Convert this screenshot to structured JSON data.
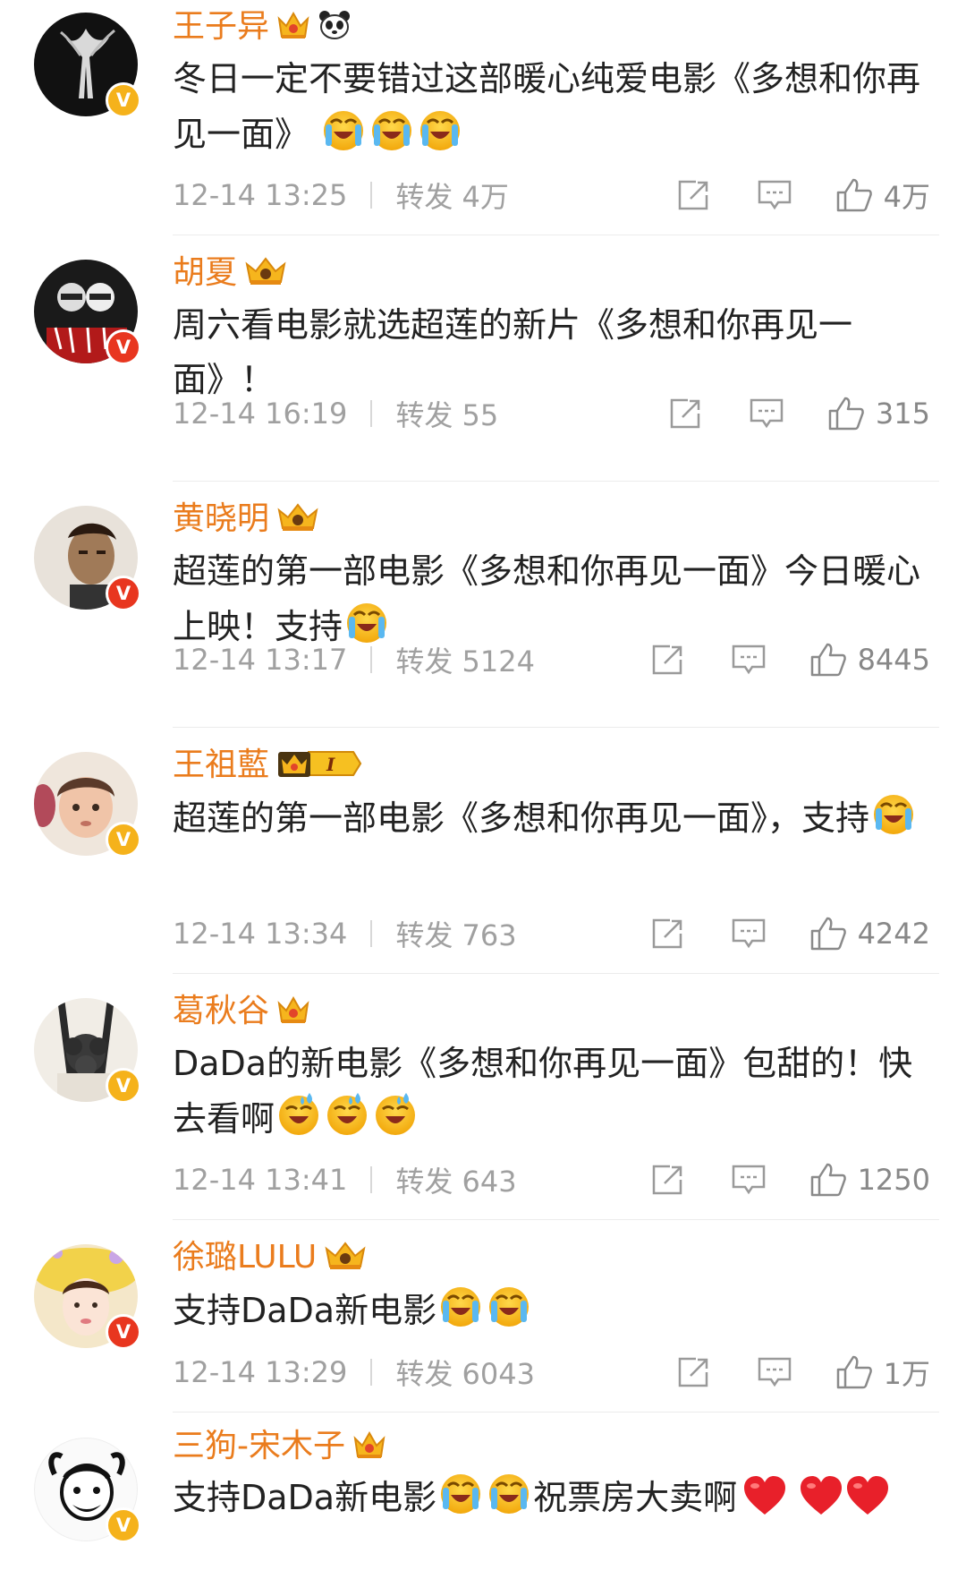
{
  "comments": [
    {
      "username": "王子异",
      "badge": "crown-badge",
      "extra_badge": "panda-icon",
      "verified": "gold",
      "text": "冬日一定不要错过这部暖心纯爱电影《多想和你再见一面》",
      "emojis": [
        "crying-emoji",
        "crying-emoji",
        "crying-emoji"
      ],
      "time": "12-14 13:25",
      "repost": "转发 4万",
      "likes": "4万"
    },
    {
      "username": "胡夏",
      "badge": "crown-badge",
      "verified": "red",
      "text": "周六看电影就选超莲的新片《多想和你再见一面》！",
      "emojis": [],
      "time": "12-14 16:19",
      "repost": "转发 55",
      "likes": "315"
    },
    {
      "username": "黄晓明",
      "badge": "crown-badge",
      "verified": "red",
      "text": "超莲的第一部电影《多想和你再见一面》今日暖心上映！支持",
      "emojis": [
        "crying-emoji"
      ],
      "time": "12-14 13:17",
      "repost": "转发 5124",
      "likes": "8445"
    },
    {
      "username": "王祖藍",
      "badge": "crown-level-badge",
      "badge_level": "I",
      "verified": "gold",
      "text": "超莲的第一部电影《多想和你再见一面》，支持",
      "emojis": [
        "crying-emoji"
      ],
      "time": "12-14 13:34",
      "repost": "转发 763",
      "likes": "4242"
    },
    {
      "username": "葛秋谷",
      "badge": "crown-badge",
      "verified": "gold",
      "text": "DaDa的新电影《多想和你再见一面》包甜的！快去看啊",
      "emojis": [
        "sweat-laugh-emoji",
        "sweat-laugh-emoji",
        "sweat-laugh-emoji"
      ],
      "time": "12-14 13:41",
      "repost": "转发 643",
      "likes": "1250"
    },
    {
      "username": "徐璐LULU",
      "badge": "crown-badge",
      "verified": "red",
      "text": "支持DaDa新电影",
      "emojis": [
        "crying-emoji",
        "crying-emoji"
      ],
      "time": "12-14 13:29",
      "repost": "转发 6043",
      "likes": "1万"
    },
    {
      "username": "三狗-宋木子",
      "badge": "crown-badge",
      "verified": "gold",
      "text": "支持DaDa新电影",
      "emojis": [
        "crying-emoji",
        "crying-emoji"
      ],
      "text_after": "祝票房大卖啊",
      "hearts": [
        "heart-icon",
        "heart-icon",
        "heart-icon"
      ]
    }
  ],
  "colors": {
    "username": "#ea7c1d",
    "verified_gold": "#f5b21b",
    "verified_red": "#e8361f",
    "meta": "#a0a0a0",
    "heart": "#e8202a"
  }
}
